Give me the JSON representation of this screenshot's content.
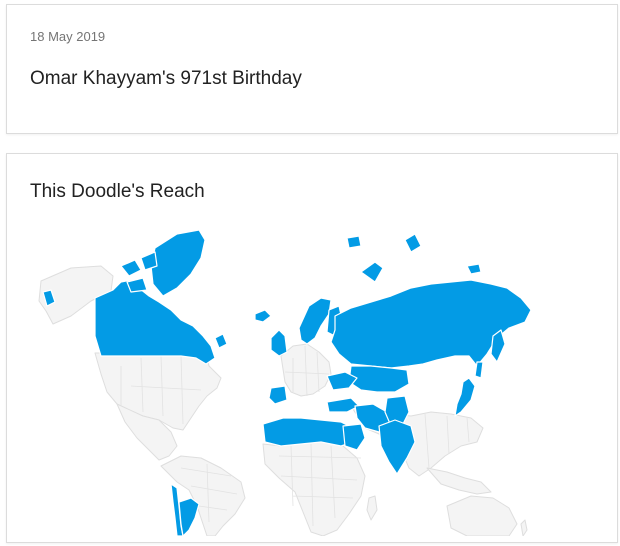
{
  "doodle": {
    "date": "18 May 2019",
    "title": "Omar Khayyam's 971st Birthday"
  },
  "reach": {
    "title": "This Doodle's Reach",
    "highlight_color": "#039be5",
    "countries": [
      "Greenland",
      "Canada",
      "Chile",
      "Argentina",
      "United Kingdom",
      "Ireland",
      "Portugal",
      "Spain",
      "Norway",
      "Sweden",
      "Finland",
      "Iceland",
      "Russia",
      "Kazakhstan",
      "Ukraine",
      "Turkey",
      "Syria",
      "Iraq",
      "Iran",
      "Afghanistan",
      "Pakistan",
      "India",
      "Azerbaijan",
      "Turkmenistan",
      "Uzbekistan",
      "Morocco",
      "Algeria",
      "Tunisia",
      "Libya",
      "Egypt",
      "Saudi Arabia",
      "Jordan",
      "Israel",
      "Japan",
      "Svalbard",
      "Franz Josef Land",
      "New Siberian Islands"
    ]
  }
}
